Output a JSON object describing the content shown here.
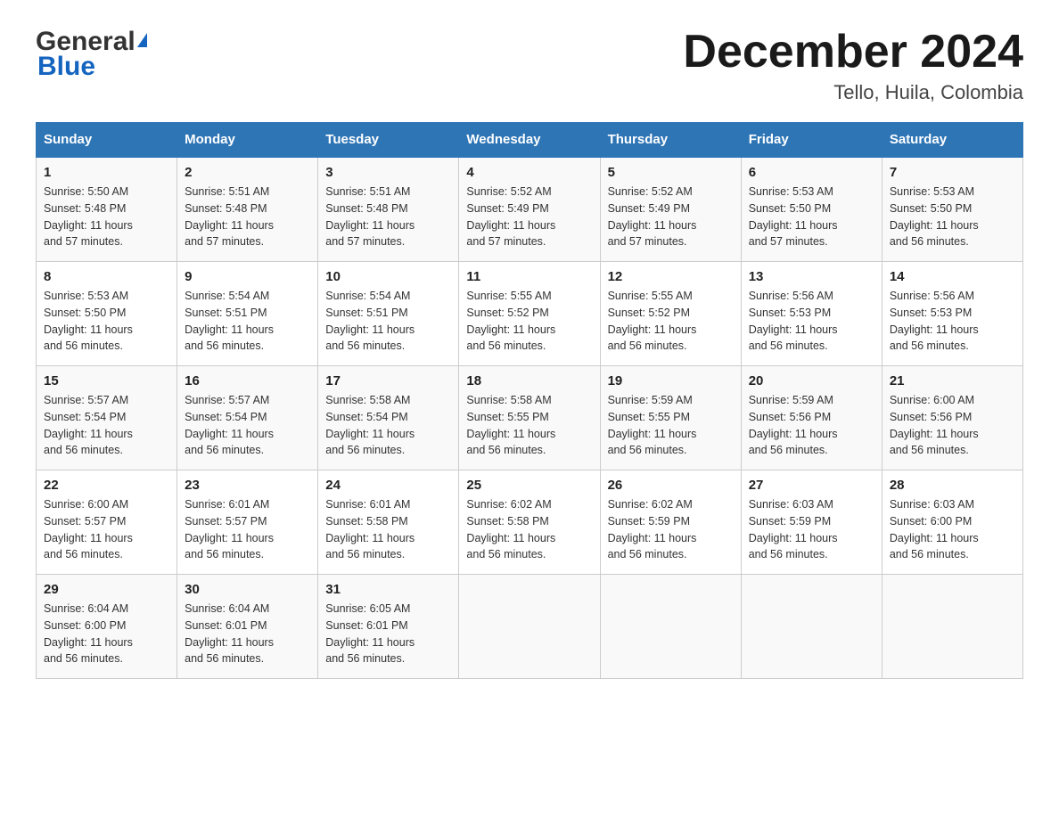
{
  "logo": {
    "general": "General",
    "blue": "Blue",
    "triangle": "▲"
  },
  "title": "December 2024",
  "subtitle": "Tello, Huila, Colombia",
  "days_of_week": [
    "Sunday",
    "Monday",
    "Tuesday",
    "Wednesday",
    "Thursday",
    "Friday",
    "Saturday"
  ],
  "weeks": [
    [
      {
        "day": "1",
        "sunrise": "5:50 AM",
        "sunset": "5:48 PM",
        "daylight": "11 hours and 57 minutes."
      },
      {
        "day": "2",
        "sunrise": "5:51 AM",
        "sunset": "5:48 PM",
        "daylight": "11 hours and 57 minutes."
      },
      {
        "day": "3",
        "sunrise": "5:51 AM",
        "sunset": "5:48 PM",
        "daylight": "11 hours and 57 minutes."
      },
      {
        "day": "4",
        "sunrise": "5:52 AM",
        "sunset": "5:49 PM",
        "daylight": "11 hours and 57 minutes."
      },
      {
        "day": "5",
        "sunrise": "5:52 AM",
        "sunset": "5:49 PM",
        "daylight": "11 hours and 57 minutes."
      },
      {
        "day": "6",
        "sunrise": "5:53 AM",
        "sunset": "5:50 PM",
        "daylight": "11 hours and 57 minutes."
      },
      {
        "day": "7",
        "sunrise": "5:53 AM",
        "sunset": "5:50 PM",
        "daylight": "11 hours and 56 minutes."
      }
    ],
    [
      {
        "day": "8",
        "sunrise": "5:53 AM",
        "sunset": "5:50 PM",
        "daylight": "11 hours and 56 minutes."
      },
      {
        "day": "9",
        "sunrise": "5:54 AM",
        "sunset": "5:51 PM",
        "daylight": "11 hours and 56 minutes."
      },
      {
        "day": "10",
        "sunrise": "5:54 AM",
        "sunset": "5:51 PM",
        "daylight": "11 hours and 56 minutes."
      },
      {
        "day": "11",
        "sunrise": "5:55 AM",
        "sunset": "5:52 PM",
        "daylight": "11 hours and 56 minutes."
      },
      {
        "day": "12",
        "sunrise": "5:55 AM",
        "sunset": "5:52 PM",
        "daylight": "11 hours and 56 minutes."
      },
      {
        "day": "13",
        "sunrise": "5:56 AM",
        "sunset": "5:53 PM",
        "daylight": "11 hours and 56 minutes."
      },
      {
        "day": "14",
        "sunrise": "5:56 AM",
        "sunset": "5:53 PM",
        "daylight": "11 hours and 56 minutes."
      }
    ],
    [
      {
        "day": "15",
        "sunrise": "5:57 AM",
        "sunset": "5:54 PM",
        "daylight": "11 hours and 56 minutes."
      },
      {
        "day": "16",
        "sunrise": "5:57 AM",
        "sunset": "5:54 PM",
        "daylight": "11 hours and 56 minutes."
      },
      {
        "day": "17",
        "sunrise": "5:58 AM",
        "sunset": "5:54 PM",
        "daylight": "11 hours and 56 minutes."
      },
      {
        "day": "18",
        "sunrise": "5:58 AM",
        "sunset": "5:55 PM",
        "daylight": "11 hours and 56 minutes."
      },
      {
        "day": "19",
        "sunrise": "5:59 AM",
        "sunset": "5:55 PM",
        "daylight": "11 hours and 56 minutes."
      },
      {
        "day": "20",
        "sunrise": "5:59 AM",
        "sunset": "5:56 PM",
        "daylight": "11 hours and 56 minutes."
      },
      {
        "day": "21",
        "sunrise": "6:00 AM",
        "sunset": "5:56 PM",
        "daylight": "11 hours and 56 minutes."
      }
    ],
    [
      {
        "day": "22",
        "sunrise": "6:00 AM",
        "sunset": "5:57 PM",
        "daylight": "11 hours and 56 minutes."
      },
      {
        "day": "23",
        "sunrise": "6:01 AM",
        "sunset": "5:57 PM",
        "daylight": "11 hours and 56 minutes."
      },
      {
        "day": "24",
        "sunrise": "6:01 AM",
        "sunset": "5:58 PM",
        "daylight": "11 hours and 56 minutes."
      },
      {
        "day": "25",
        "sunrise": "6:02 AM",
        "sunset": "5:58 PM",
        "daylight": "11 hours and 56 minutes."
      },
      {
        "day": "26",
        "sunrise": "6:02 AM",
        "sunset": "5:59 PM",
        "daylight": "11 hours and 56 minutes."
      },
      {
        "day": "27",
        "sunrise": "6:03 AM",
        "sunset": "5:59 PM",
        "daylight": "11 hours and 56 minutes."
      },
      {
        "day": "28",
        "sunrise": "6:03 AM",
        "sunset": "6:00 PM",
        "daylight": "11 hours and 56 minutes."
      }
    ],
    [
      {
        "day": "29",
        "sunrise": "6:04 AM",
        "sunset": "6:00 PM",
        "daylight": "11 hours and 56 minutes."
      },
      {
        "day": "30",
        "sunrise": "6:04 AM",
        "sunset": "6:01 PM",
        "daylight": "11 hours and 56 minutes."
      },
      {
        "day": "31",
        "sunrise": "6:05 AM",
        "sunset": "6:01 PM",
        "daylight": "11 hours and 56 minutes."
      },
      {
        "day": "",
        "sunrise": "",
        "sunset": "",
        "daylight": ""
      },
      {
        "day": "",
        "sunrise": "",
        "sunset": "",
        "daylight": ""
      },
      {
        "day": "",
        "sunrise": "",
        "sunset": "",
        "daylight": ""
      },
      {
        "day": "",
        "sunrise": "",
        "sunset": "",
        "daylight": ""
      }
    ]
  ],
  "labels": {
    "sunrise": "Sunrise:",
    "sunset": "Sunset:",
    "daylight": "Daylight:"
  }
}
